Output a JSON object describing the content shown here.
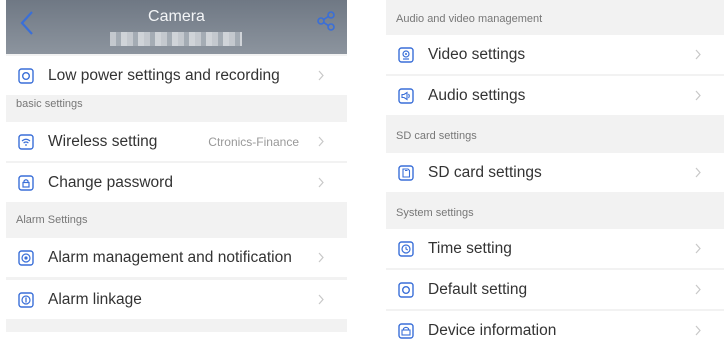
{
  "left": {
    "header": {
      "title": "Camera"
    },
    "items": [
      {
        "label": "Low power settings and recording",
        "icon": "gear-icon"
      }
    ],
    "sections": [
      {
        "title": "basic settings",
        "items": [
          {
            "label": "Wireless setting",
            "value": "Ctronics-Finance",
            "icon": "wifi-icon"
          },
          {
            "label": "Change password",
            "icon": "lock-icon"
          }
        ]
      },
      {
        "title": "Alarm Settings",
        "items": [
          {
            "label": "Alarm management and notification",
            "icon": "alarm-icon"
          },
          {
            "label": "Alarm linkage",
            "icon": "link-icon"
          }
        ]
      }
    ]
  },
  "right": {
    "sections": [
      {
        "title": "Audio and video management",
        "items": [
          {
            "label": "Video settings",
            "icon": "camera-icon"
          },
          {
            "label": "Audio settings",
            "icon": "speaker-icon"
          }
        ]
      },
      {
        "title": "SD card settings",
        "items": [
          {
            "label": "SD card settings",
            "icon": "sd-card-icon"
          }
        ]
      },
      {
        "title": "System settings",
        "items": [
          {
            "label": "Time setting",
            "icon": "clock-icon"
          },
          {
            "label": "Default setting",
            "icon": "gear-icon"
          },
          {
            "label": "Device information",
            "icon": "device-info-icon"
          }
        ]
      }
    ]
  },
  "colors": {
    "accent": "#3a6fd8",
    "header": "#7a838e",
    "background": "#f2f2f2"
  }
}
